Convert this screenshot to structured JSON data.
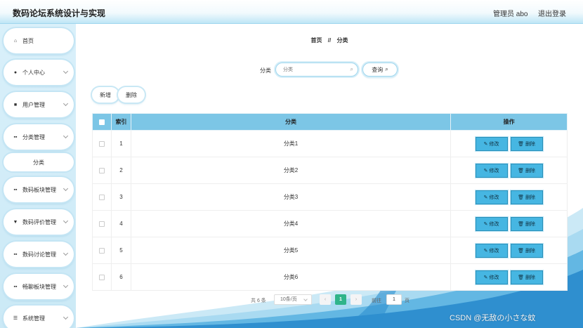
{
  "header": {
    "title": "数码论坛系统设计与实现",
    "admin": "管理员 abo",
    "logout": "退出登录"
  },
  "sidebar": {
    "items": [
      {
        "label": "首页",
        "icon": "home-icon",
        "glyph": "⌂",
        "chevron": false
      },
      {
        "label": "个人中心",
        "icon": "user-icon",
        "glyph": "●",
        "chevron": true
      },
      {
        "label": "用户管理",
        "icon": "briefcase-icon",
        "glyph": "■",
        "chevron": true
      },
      {
        "label": "分类管理",
        "icon": "grid-icon",
        "glyph": "▪▪",
        "chevron": true
      },
      {
        "label": "数码板块管理",
        "icon": "grid-icon",
        "glyph": "▪▪",
        "chevron": true
      },
      {
        "label": "数码评价管理",
        "icon": "cup-icon",
        "glyph": "▼",
        "chevron": true
      },
      {
        "label": "数码讨论管理",
        "icon": "grid-icon",
        "glyph": "▪▪",
        "chevron": true
      },
      {
        "label": "畅聊板块管理",
        "icon": "grid-icon",
        "glyph": "▪▪",
        "chevron": true
      },
      {
        "label": "系统管理",
        "icon": "sliders-icon",
        "glyph": "☰",
        "chevron": true
      }
    ],
    "sub_item": "分类"
  },
  "breadcrumb": {
    "home": "首页",
    "sep": "//",
    "current": "分类"
  },
  "search": {
    "label": "分类",
    "placeholder": "分类",
    "query_button": "查询"
  },
  "toolbar": {
    "add": "新增",
    "delete": "删除"
  },
  "table": {
    "headers": {
      "index": "索引",
      "category": "分类",
      "action": "操作"
    },
    "rows": [
      {
        "index": "1",
        "category": "分类1"
      },
      {
        "index": "2",
        "category": "分类2"
      },
      {
        "index": "3",
        "category": "分类3"
      },
      {
        "index": "4",
        "category": "分类4"
      },
      {
        "index": "5",
        "category": "分类5"
      },
      {
        "index": "6",
        "category": "分类6"
      }
    ],
    "edit_label": "修改",
    "delete_label": "删除"
  },
  "pagination": {
    "total": "共 6 条",
    "page_size": "10条/页",
    "current_page": "1",
    "goto_label": "前往",
    "goto_value": "1",
    "page_suffix": "页"
  },
  "watermark": "CSDN @无敌の小さな蚊",
  "colors": {
    "table_header": "#7cc6e6",
    "op_button": "#46b6e2",
    "active_page": "#2fb48a",
    "accent": "#9fd6ee"
  }
}
